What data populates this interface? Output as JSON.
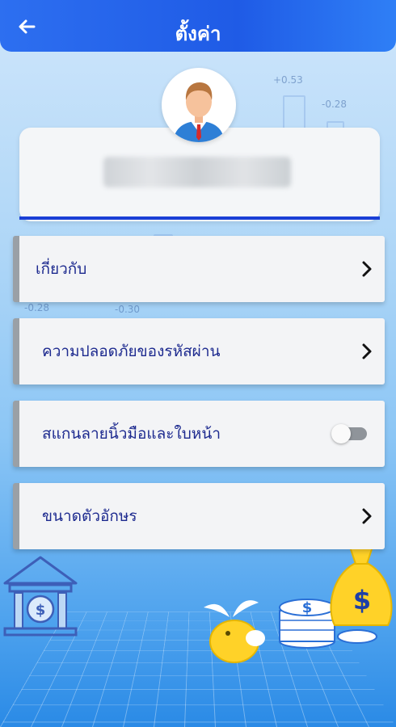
{
  "header": {
    "title": "ตั้งค่า",
    "back_icon": "back-arrow-icon"
  },
  "profile": {
    "avatar_icon": "user-avatar-icon"
  },
  "menu": [
    {
      "label": "เกี่ยวกับ",
      "control": "chevron"
    },
    {
      "label": "ความปลอดภัยของรหัสผ่าน",
      "control": "chevron"
    },
    {
      "label": "สแกนลายนิ้วมือและใบหน้า",
      "control": "toggle",
      "enabled": false
    },
    {
      "label": "ขนาดตัวอักษร",
      "control": "chevron"
    }
  ],
  "background_numbers": [
    "+0.53",
    "-0.28",
    "-0.28",
    "-0.30"
  ],
  "colors": {
    "header": "#1f5be6",
    "accent": "#1a3fd6",
    "label": "#1d2a8f"
  }
}
